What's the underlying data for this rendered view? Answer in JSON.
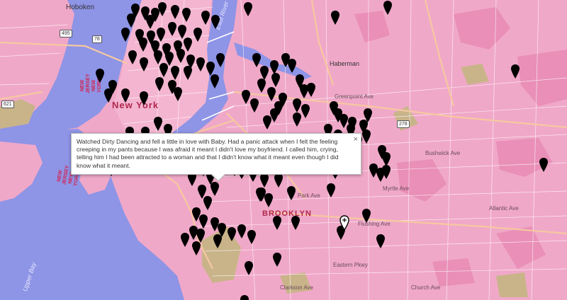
{
  "map": {
    "labels": {
      "hoboken": "Hoboken",
      "new_york": "New York",
      "brooklyn": "BROOKLYN",
      "haberman": "Haberman",
      "east_river": "East River",
      "upper_bay": "Upper Bay",
      "new_jersey_1": "NEW JERSEY NEW YORK",
      "new_jersey_2": "NEW JERSEY NEW YORK",
      "greenpoint_ave": "Greenpoint Ave",
      "flushing_ave": "Flushing Ave",
      "atlantic_ave": "Atlantic Ave",
      "myrtle_ave": "Myrtle Ave",
      "clarkson_ave": "Clarkson Ave",
      "church_ave": "Church Ave",
      "park_ave": "Park Ave",
      "bushwick_ave": "Bushwick Ave",
      "eastern_pkwy": "Eastern Pkwy"
    },
    "shields": [
      "495",
      "278",
      "621",
      "78"
    ],
    "colors": {
      "land": "#f0a8c8",
      "water": "#8e94e6",
      "park": "#c9b48a",
      "marker": "#000000",
      "highway": "#f6c8a0"
    },
    "icons": {
      "marker": "map-pin-icon",
      "selected_marker": "map-pin-outline-icon",
      "close": "close-icon"
    }
  },
  "popup": {
    "text": "Watched Dirty Dancing and fell a little in love with Baby. Had a panic attack when I felt the feeling creeping in my pants because I was afraid it meant I didn't love my boyfriend. I called him, crying, telling him I had been attracted to a woman and that I didn't know what it meant even though I did know what it meant.",
    "close_label": "×"
  }
}
